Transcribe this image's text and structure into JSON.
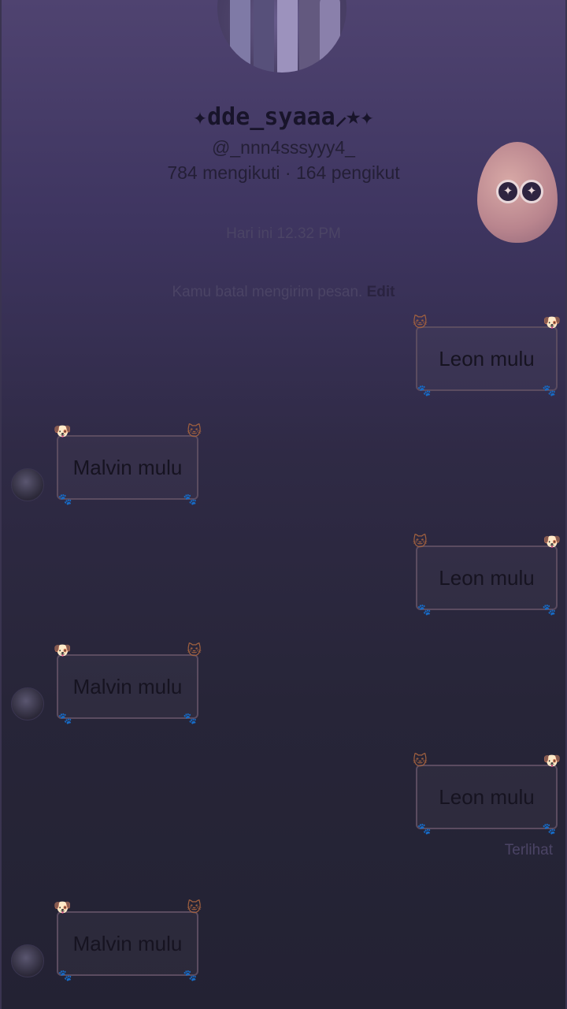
{
  "profile": {
    "display_name": "✦dde_syaaa⸝⭑✦",
    "username": "@_nnn4sssyyy4_",
    "stats": "784 mengikuti · 164 pengikut"
  },
  "chat": {
    "timestamp": "Hari ini 12.32 PM",
    "unsent_notice": "Kamu batal mengirim pesan.",
    "edit_label": "Edit",
    "seen_label": "Terlihat",
    "messages": [
      {
        "side": "sent",
        "text": "Leon mulu"
      },
      {
        "side": "received",
        "text": "Malvin mulu"
      },
      {
        "side": "sent",
        "text": "Leon mulu"
      },
      {
        "side": "received",
        "text": "Malvin mulu"
      },
      {
        "side": "sent",
        "text": "Leon mulu"
      },
      {
        "side": "received",
        "text": "Malvin mulu"
      }
    ]
  },
  "icons": {
    "profile_photo": "profile-photo-icon",
    "egg_sticker": "egg-sticker-icon",
    "cat_decoration": "cat-face-icon",
    "dog_decoration": "dog-face-icon",
    "paw_decoration": "paw-icon"
  },
  "colors": {
    "background_top": "#4f4370",
    "background_bottom": "#232233",
    "bubble_border": "#5b4c60"
  }
}
